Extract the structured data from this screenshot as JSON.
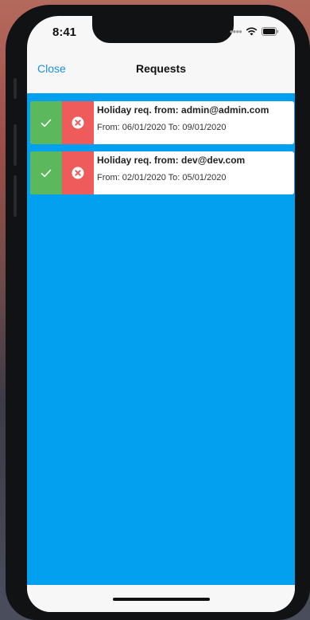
{
  "status_bar": {
    "time": "8:41"
  },
  "nav": {
    "close_label": "Close",
    "title": "Requests"
  },
  "requests": [
    {
      "title": "Holiday req. from: admin@admin.com",
      "dates": "From: 06/01/2020 To: 09/01/2020"
    },
    {
      "title": "Holiday req. from: dev@dev.com",
      "dates": "From: 02/01/2020 To: 05/01/2020"
    }
  ],
  "icons": {
    "approve": "checkmark-icon",
    "reject": "x-circle-icon",
    "wifi": "wifi-icon",
    "battery": "battery-icon"
  },
  "colors": {
    "list_background": "#03a0ef",
    "approve": "#5cb85c",
    "reject": "#ef5b5b",
    "link": "#1a8fe0"
  }
}
